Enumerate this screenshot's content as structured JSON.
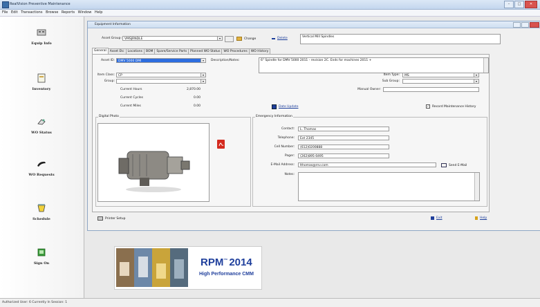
{
  "window": {
    "title": "RealVision Preventive Maintenance"
  },
  "menu": [
    "File",
    "Edit",
    "Transactions",
    "Browse",
    "Reports",
    "Window",
    "Help"
  ],
  "nav": [
    {
      "label": "Equip Info",
      "icon": "equipment-icon"
    },
    {
      "label": "Inventory",
      "icon": "inventory-icon"
    },
    {
      "label": "WO Status",
      "icon": "wo-status-icon"
    },
    {
      "label": "WO Requests",
      "icon": "wo-requests-icon"
    },
    {
      "label": "Schedule",
      "icon": "schedule-icon"
    },
    {
      "label": "Sign On",
      "icon": "sign-on-icon"
    }
  ],
  "child": {
    "title": "Equipment Information",
    "asset_group_label": "Asset Group:",
    "asset_group_value": "VMSJRNDLE",
    "change_label": "Change",
    "delete_label": "Delete",
    "header_note": "Vertical Mill Spindles",
    "tabs": [
      "General",
      "Asset Etc",
      "Locations",
      "BOM",
      "Spare/Service Parts",
      "Planned WO Status",
      "WO Procedures",
      "WO History"
    ],
    "asset_id_label": "Asset ID:",
    "asset_id_value": "DMV 5000 DMI",
    "description_label": "Description/Notes:",
    "description_value": "6\" Spindle for DMV 5000 2011 - revision 2C. Ends for machines 2011 +",
    "item_class_label": "Item Class:",
    "item_class_value": "CP",
    "group_label": "Group:",
    "group_value": "",
    "item_type_label": "Item Type:",
    "item_type_value": "MS",
    "sub_group_label": "Sub Group:",
    "sub_group_value": "",
    "manual_owner_label": "Manual Owner:",
    "manual_owner_value": "",
    "current_hours_label": "Current Hours",
    "current_hours_value": "2,870.00",
    "current_cycles_label": "Current Cycles",
    "current_cycles_value": "0.00",
    "current_miles_label": "Current Miles",
    "current_miles_value": "0.00",
    "date_update_label": "Date Update",
    "record_history_label": "Record Maintenance History",
    "digital_photo_label": "Digital Photo",
    "emergency_label": "Emergency Information",
    "contact_label": "Contact:",
    "contact_value": "L. Thomas",
    "telephone_label": "Telephone:",
    "telephone_value": "Ext 2345",
    "cell_label": "Cell Number:",
    "cell_value": "(612)0200888",
    "pager_label": "Pager:",
    "pager_value": "(262)895-0495",
    "email_label": "E-Mail Address:",
    "email_value": "lthomas@rnv.com",
    "send_email_label": "Send E-Mail",
    "notes_label": "Notes:",
    "notes_value": "",
    "printer_setup_label": "Printer Setup",
    "exit_label": "Exit",
    "help_label": "Help"
  },
  "banner": {
    "title": "RPM",
    "superscript": "™",
    "year": "2014",
    "subtitle": "High Performance CMM"
  },
  "status": "Authorized User: 6   Currently In Session: 1",
  "colors": {
    "accent_blue": "#1a3c9a",
    "banner_blue": "#1f3f9c",
    "selected_field": "#2c6de0"
  }
}
